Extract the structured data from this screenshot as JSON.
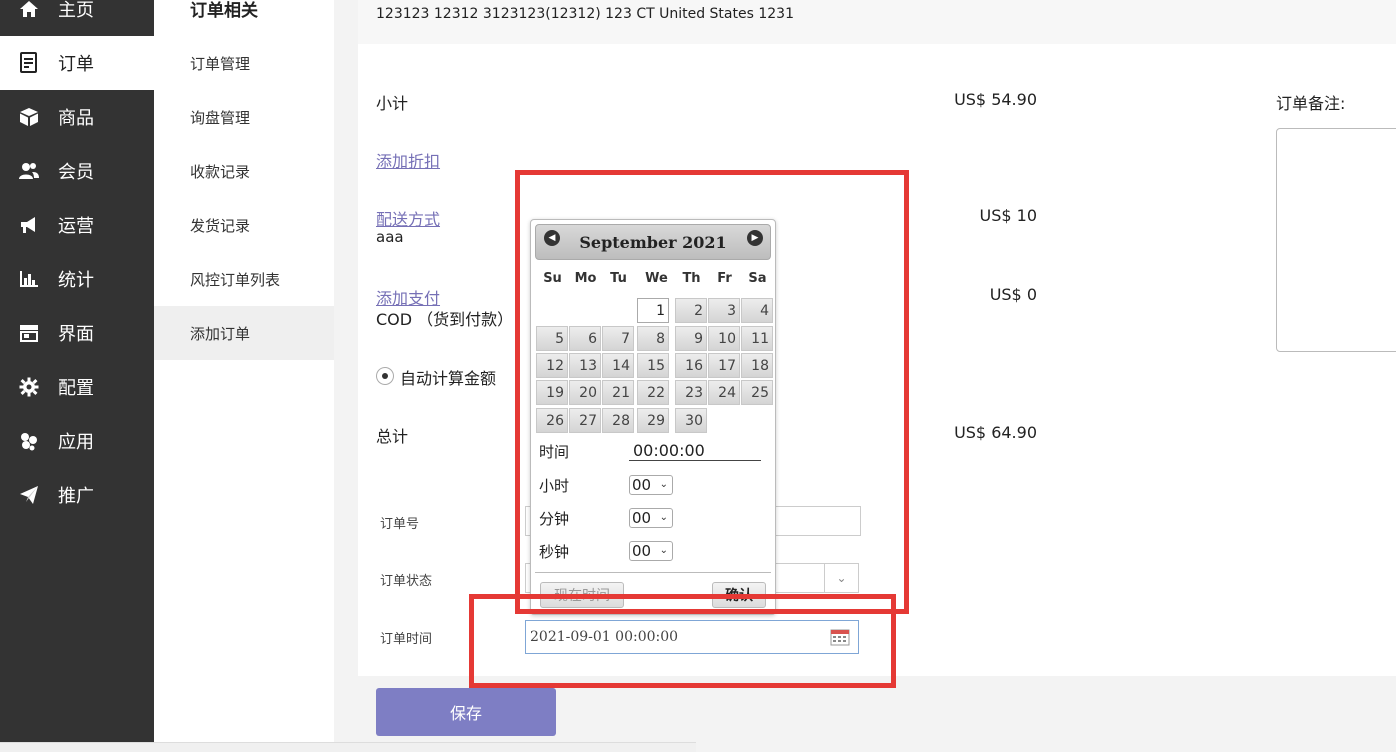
{
  "sidebar": {
    "items": [
      {
        "label": "主页",
        "icon": "home-icon"
      },
      {
        "label": "订单",
        "icon": "order-icon"
      },
      {
        "label": "商品",
        "icon": "box-icon"
      },
      {
        "label": "会员",
        "icon": "users-icon"
      },
      {
        "label": "运营",
        "icon": "megaphone-icon"
      },
      {
        "label": "统计",
        "icon": "bar-chart-icon"
      },
      {
        "label": "界面",
        "icon": "storefront-icon"
      },
      {
        "label": "配置",
        "icon": "gear-icon"
      },
      {
        "label": "应用",
        "icon": "puzzle-icon"
      },
      {
        "label": "推广",
        "icon": "paper-plane-icon"
      }
    ]
  },
  "submenu": {
    "title": "订单相关",
    "items": [
      "订单管理",
      "询盘管理",
      "收款记录",
      "发货记录",
      "风控订单列表",
      "添加订单"
    ]
  },
  "address": "123123 12312 3123123(12312) 123 CT United States 1231",
  "summary": {
    "subtotal_label": "小计",
    "subtotal_value": "US$ 54.90",
    "add_discount": "添加折扣",
    "shipping_link": "配送方式",
    "shipping_method": "aaa",
    "shipping_value": "US$ 10",
    "payment_link": "添加支付",
    "payment_method": "COD （货到付款）",
    "payment_value": "US$ 0",
    "auto_calc": "自动计算金额",
    "total_label": "总计",
    "total_value": "US$ 64.90",
    "note_label": "订单备注:"
  },
  "form": {
    "order_no_label": "订单号",
    "order_status_label": "订单状态",
    "order_time_label": "订单时间",
    "order_time_value": "2021-09-01 00:00:00"
  },
  "save_label": "保存",
  "datepicker": {
    "month_title": "September 2021",
    "weekdays": [
      "Su",
      "Mo",
      "Tu",
      "We",
      "Th",
      "Fr",
      "Sa"
    ],
    "days": [
      "1",
      "2",
      "3",
      "4",
      "5",
      "6",
      "7",
      "8",
      "9",
      "10",
      "11",
      "12",
      "13",
      "14",
      "15",
      "16",
      "17",
      "18",
      "19",
      "20",
      "21",
      "22",
      "23",
      "24",
      "25",
      "26",
      "27",
      "28",
      "29",
      "30"
    ],
    "current_day": "1",
    "time_label": "时间",
    "time_value": "00:00:00",
    "hour_label": "小时",
    "hour_value": "00",
    "minute_label": "分钟",
    "minute_value": "00",
    "second_label": "秒钟",
    "second_value": "00",
    "now_button": "现在时间",
    "ok_button": "确认"
  },
  "colors": {
    "sidebar_bg": "#333333",
    "link": "#7670b6",
    "save_button": "#7e7ec4",
    "highlight_box": "#e53935"
  }
}
